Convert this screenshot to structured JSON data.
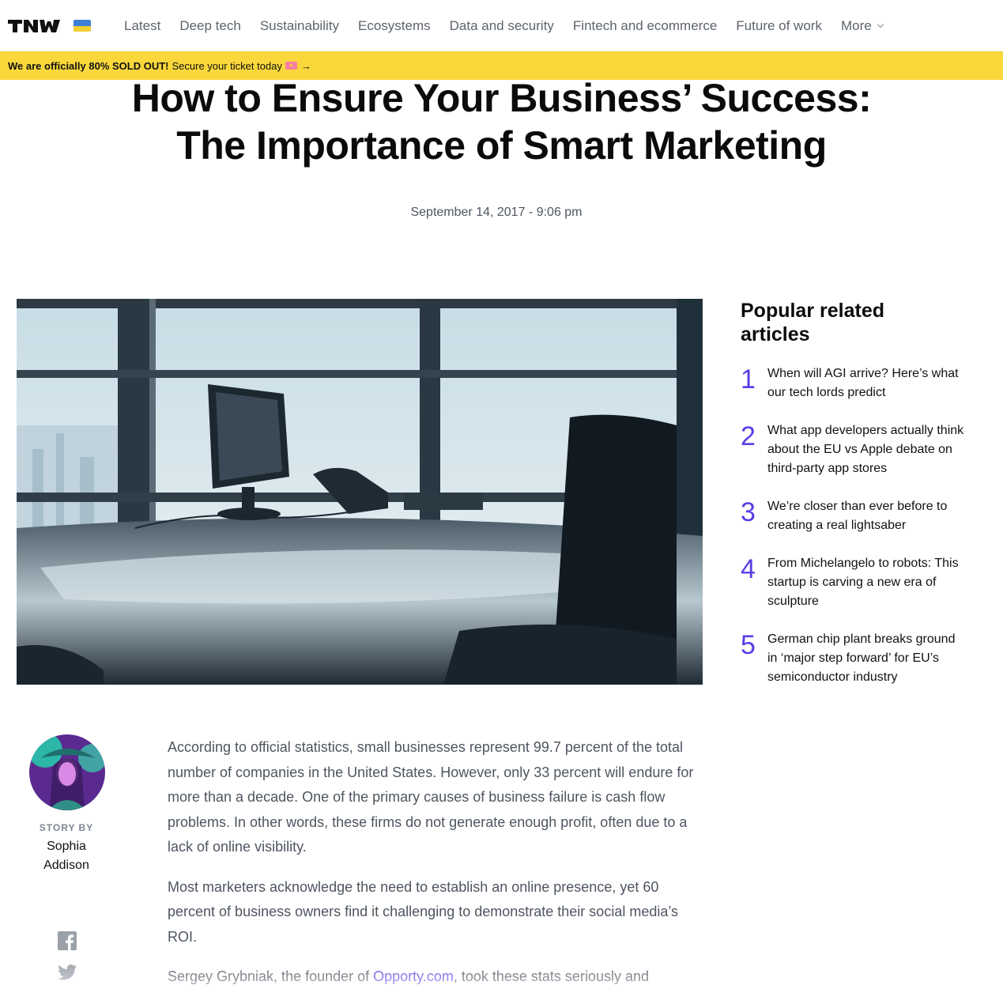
{
  "nav": {
    "logo_text": "TNW",
    "links": [
      "Latest",
      "Deep tech",
      "Sustainability",
      "Ecosystems",
      "Data and security",
      "Fintech and ecommerce",
      "Future of work"
    ],
    "more_label": "More"
  },
  "banner": {
    "strong": "We are officially 80% SOLD OUT!",
    "text": "Secure your ticket today",
    "arrow": "→"
  },
  "article": {
    "title_line1": "How to Ensure Your Business’ Success:",
    "title_line2": "The Importance of Smart Marketing",
    "date": "September 14, 2017 - 9:06 pm",
    "paragraphs": [
      "According to official statistics, small businesses represent 99.7 percent of the total number of companies in the United States. However, only 33 percent will endure for more than a decade. One of the primary causes of business failure is cash flow problems. In other words, these firms do not generate enough profit, often due to a lack of online visibility.",
      "Most marketers acknowledge the need to establish an online presence, yet 60 percent of business owners find it challenging to demonstrate their social media’s ROI."
    ],
    "para3_before": "Sergey Grybniak, the founder of ",
    "para3_link": "Opporty.com",
    "para3_after": ", took these stats seriously and"
  },
  "author": {
    "story_by": "STORY BY",
    "name_line1": "Sophia",
    "name_line2": "Addison"
  },
  "sidebar": {
    "title_line1": "Popular related",
    "title_line2": "articles",
    "items": [
      {
        "num": "1",
        "title": "When will AGI arrive? Here’s what our tech lords predict"
      },
      {
        "num": "2",
        "title": "What app developers actually think about the EU vs Apple debate on third-party app stores"
      },
      {
        "num": "3",
        "title": "We’re closer than ever before to creating a real lightsaber"
      },
      {
        "num": "4",
        "title": "From Michelangelo to robots: This startup is carving a new era of sculpture"
      },
      {
        "num": "5",
        "title": "German chip plant breaks ground in ‘major step forward’ for EU’s semiconductor industry"
      }
    ]
  },
  "colors": {
    "accent": "#5b3de4",
    "banner": "#fad83b",
    "nav_text": "#5d646e",
    "body_text": "#4e5560"
  },
  "icons": [
    "tnw-logo",
    "ukraine-flag-icon",
    "chevron-down-icon",
    "ticket-icon",
    "facebook-icon",
    "twitter-icon"
  ]
}
